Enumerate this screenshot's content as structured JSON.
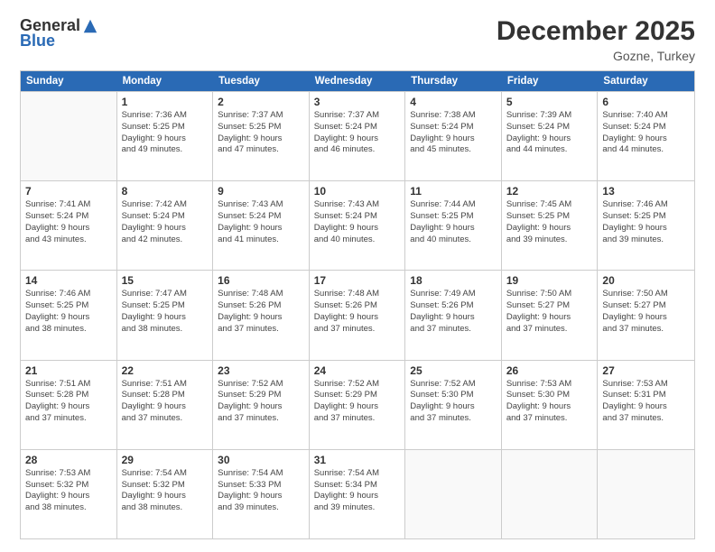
{
  "logo": {
    "general": "General",
    "blue": "Blue"
  },
  "title": "December 2025",
  "location": "Gozne, Turkey",
  "days": [
    "Sunday",
    "Monday",
    "Tuesday",
    "Wednesday",
    "Thursday",
    "Friday",
    "Saturday"
  ],
  "weeks": [
    [
      {
        "day": "",
        "info": ""
      },
      {
        "day": "1",
        "info": "Sunrise: 7:36 AM\nSunset: 5:25 PM\nDaylight: 9 hours\nand 49 minutes."
      },
      {
        "day": "2",
        "info": "Sunrise: 7:37 AM\nSunset: 5:25 PM\nDaylight: 9 hours\nand 47 minutes."
      },
      {
        "day": "3",
        "info": "Sunrise: 7:37 AM\nSunset: 5:24 PM\nDaylight: 9 hours\nand 46 minutes."
      },
      {
        "day": "4",
        "info": "Sunrise: 7:38 AM\nSunset: 5:24 PM\nDaylight: 9 hours\nand 45 minutes."
      },
      {
        "day": "5",
        "info": "Sunrise: 7:39 AM\nSunset: 5:24 PM\nDaylight: 9 hours\nand 44 minutes."
      },
      {
        "day": "6",
        "info": "Sunrise: 7:40 AM\nSunset: 5:24 PM\nDaylight: 9 hours\nand 44 minutes."
      }
    ],
    [
      {
        "day": "7",
        "info": "Sunrise: 7:41 AM\nSunset: 5:24 PM\nDaylight: 9 hours\nand 43 minutes."
      },
      {
        "day": "8",
        "info": "Sunrise: 7:42 AM\nSunset: 5:24 PM\nDaylight: 9 hours\nand 42 minutes."
      },
      {
        "day": "9",
        "info": "Sunrise: 7:43 AM\nSunset: 5:24 PM\nDaylight: 9 hours\nand 41 minutes."
      },
      {
        "day": "10",
        "info": "Sunrise: 7:43 AM\nSunset: 5:24 PM\nDaylight: 9 hours\nand 40 minutes."
      },
      {
        "day": "11",
        "info": "Sunrise: 7:44 AM\nSunset: 5:25 PM\nDaylight: 9 hours\nand 40 minutes."
      },
      {
        "day": "12",
        "info": "Sunrise: 7:45 AM\nSunset: 5:25 PM\nDaylight: 9 hours\nand 39 minutes."
      },
      {
        "day": "13",
        "info": "Sunrise: 7:46 AM\nSunset: 5:25 PM\nDaylight: 9 hours\nand 39 minutes."
      }
    ],
    [
      {
        "day": "14",
        "info": "Sunrise: 7:46 AM\nSunset: 5:25 PM\nDaylight: 9 hours\nand 38 minutes."
      },
      {
        "day": "15",
        "info": "Sunrise: 7:47 AM\nSunset: 5:25 PM\nDaylight: 9 hours\nand 38 minutes."
      },
      {
        "day": "16",
        "info": "Sunrise: 7:48 AM\nSunset: 5:26 PM\nDaylight: 9 hours\nand 37 minutes."
      },
      {
        "day": "17",
        "info": "Sunrise: 7:48 AM\nSunset: 5:26 PM\nDaylight: 9 hours\nand 37 minutes."
      },
      {
        "day": "18",
        "info": "Sunrise: 7:49 AM\nSunset: 5:26 PM\nDaylight: 9 hours\nand 37 minutes."
      },
      {
        "day": "19",
        "info": "Sunrise: 7:50 AM\nSunset: 5:27 PM\nDaylight: 9 hours\nand 37 minutes."
      },
      {
        "day": "20",
        "info": "Sunrise: 7:50 AM\nSunset: 5:27 PM\nDaylight: 9 hours\nand 37 minutes."
      }
    ],
    [
      {
        "day": "21",
        "info": "Sunrise: 7:51 AM\nSunset: 5:28 PM\nDaylight: 9 hours\nand 37 minutes."
      },
      {
        "day": "22",
        "info": "Sunrise: 7:51 AM\nSunset: 5:28 PM\nDaylight: 9 hours\nand 37 minutes."
      },
      {
        "day": "23",
        "info": "Sunrise: 7:52 AM\nSunset: 5:29 PM\nDaylight: 9 hours\nand 37 minutes."
      },
      {
        "day": "24",
        "info": "Sunrise: 7:52 AM\nSunset: 5:29 PM\nDaylight: 9 hours\nand 37 minutes."
      },
      {
        "day": "25",
        "info": "Sunrise: 7:52 AM\nSunset: 5:30 PM\nDaylight: 9 hours\nand 37 minutes."
      },
      {
        "day": "26",
        "info": "Sunrise: 7:53 AM\nSunset: 5:30 PM\nDaylight: 9 hours\nand 37 minutes."
      },
      {
        "day": "27",
        "info": "Sunrise: 7:53 AM\nSunset: 5:31 PM\nDaylight: 9 hours\nand 37 minutes."
      }
    ],
    [
      {
        "day": "28",
        "info": "Sunrise: 7:53 AM\nSunset: 5:32 PM\nDaylight: 9 hours\nand 38 minutes."
      },
      {
        "day": "29",
        "info": "Sunrise: 7:54 AM\nSunset: 5:32 PM\nDaylight: 9 hours\nand 38 minutes."
      },
      {
        "day": "30",
        "info": "Sunrise: 7:54 AM\nSunset: 5:33 PM\nDaylight: 9 hours\nand 39 minutes."
      },
      {
        "day": "31",
        "info": "Sunrise: 7:54 AM\nSunset: 5:34 PM\nDaylight: 9 hours\nand 39 minutes."
      },
      {
        "day": "",
        "info": ""
      },
      {
        "day": "",
        "info": ""
      },
      {
        "day": "",
        "info": ""
      }
    ]
  ]
}
